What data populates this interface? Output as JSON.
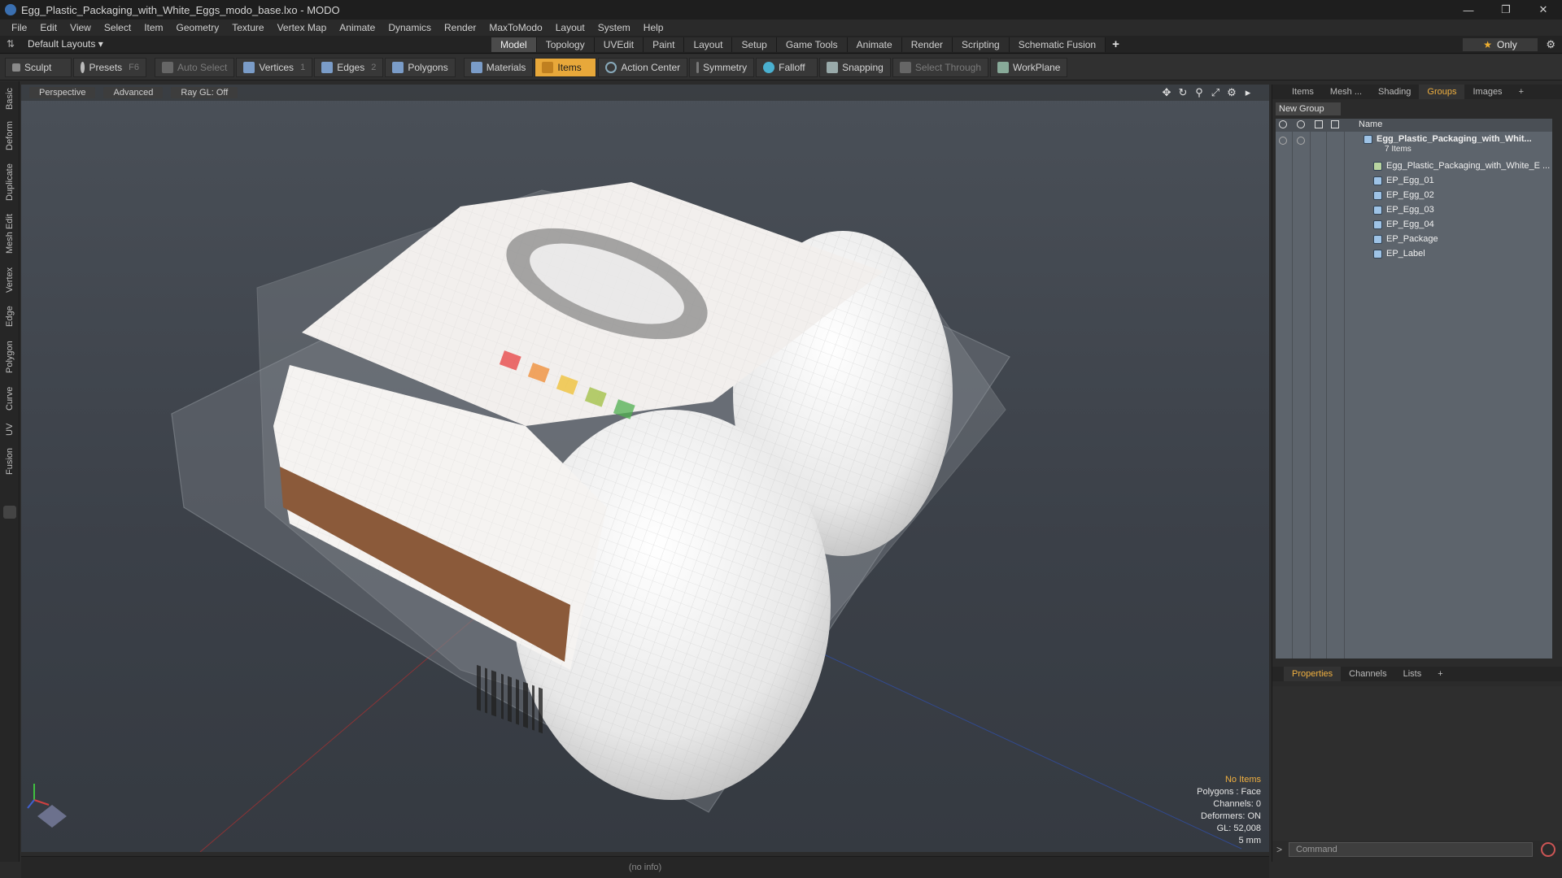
{
  "window": {
    "title": "Egg_Plastic_Packaging_with_White_Eggs_modo_base.lxo - MODO"
  },
  "menu": [
    "File",
    "Edit",
    "View",
    "Select",
    "Item",
    "Geometry",
    "Texture",
    "Vertex Map",
    "Animate",
    "Dynamics",
    "Render",
    "MaxToModo",
    "Layout",
    "System",
    "Help"
  ],
  "layout": {
    "selector": "Default Layouts",
    "tabs": [
      "Model",
      "Topology",
      "UVEdit",
      "Paint",
      "Layout",
      "Setup",
      "Game Tools",
      "Animate",
      "Render",
      "Scripting",
      "Schematic Fusion"
    ],
    "active_tab": "Model",
    "only_label": "Only"
  },
  "toolbar": {
    "sculpt": "Sculpt",
    "presets": "Presets",
    "presets_hotkey": "F6",
    "auto_select": "Auto Select",
    "vertices": "Vertices",
    "vertices_key": "1",
    "edges": "Edges",
    "edges_key": "2",
    "polygons": "Polygons",
    "materials": "Materials",
    "items": "Items",
    "action_center": "Action Center",
    "symmetry": "Symmetry",
    "falloff": "Falloff",
    "snapping": "Snapping",
    "select_through": "Select Through",
    "workplane": "WorkPlane"
  },
  "left_tabs": [
    "Basic",
    "Deform",
    "Duplicate",
    "Mesh Edit",
    "Vertex",
    "Edge",
    "Polygon",
    "Curve",
    "UV",
    "Fusion"
  ],
  "viewport": {
    "view": "Perspective",
    "shading": "Advanced",
    "raygl": "Ray GL: Off",
    "info": {
      "no_items": "No Items",
      "polygons": "Polygons : Face",
      "channels": "Channels: 0",
      "deformers": "Deformers: ON",
      "gl": "GL: 52,008",
      "unit": "5 mm"
    }
  },
  "right_panel": {
    "tabs": [
      "Items",
      "Mesh ...",
      "Shading",
      "Groups",
      "Images"
    ],
    "active_tab": "Groups",
    "new_group": "New Group",
    "col_name": "Name",
    "group": {
      "name": "Egg_Plastic_Packaging_with_Whit...",
      "count": "7 Items",
      "children": [
        "Egg_Plastic_Packaging_with_White_E ...",
        "EP_Egg_01",
        "EP_Egg_02",
        "EP_Egg_03",
        "EP_Egg_04",
        "EP_Package",
        "EP_Label"
      ]
    },
    "bottom_tabs": [
      "Properties",
      "Channels",
      "Lists"
    ],
    "bottom_active": "Properties",
    "command_placeholder": "Command"
  },
  "status": {
    "text": "(no info)"
  },
  "colors": {
    "accent": "#e8a83a",
    "highlight": "#f0b040",
    "viewport_bg": "#3b4048"
  }
}
